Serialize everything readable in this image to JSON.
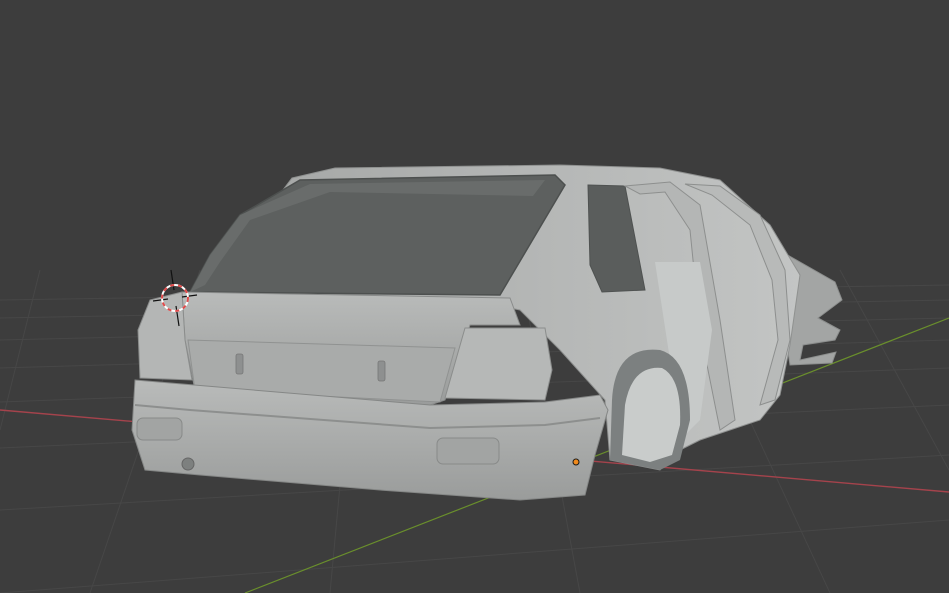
{
  "viewport": {
    "background_color": "#3d3d3d",
    "grid_color": "#474747",
    "x_axis_color": "#a5434c",
    "y_axis_color": "#6a8f2c"
  },
  "model": {
    "body_color": "#a6a8a7",
    "body_highlight_color": "#bcbebd",
    "glass_color": "#5d605f",
    "shadow_color": "#7f8382"
  },
  "cursor_3d": {
    "icon": "3d-cursor-icon",
    "ring_colors": [
      "#e04a4a",
      "#ffffff"
    ]
  },
  "origin_marker": {
    "icon": "object-origin-icon",
    "color": "#f08a1c"
  }
}
